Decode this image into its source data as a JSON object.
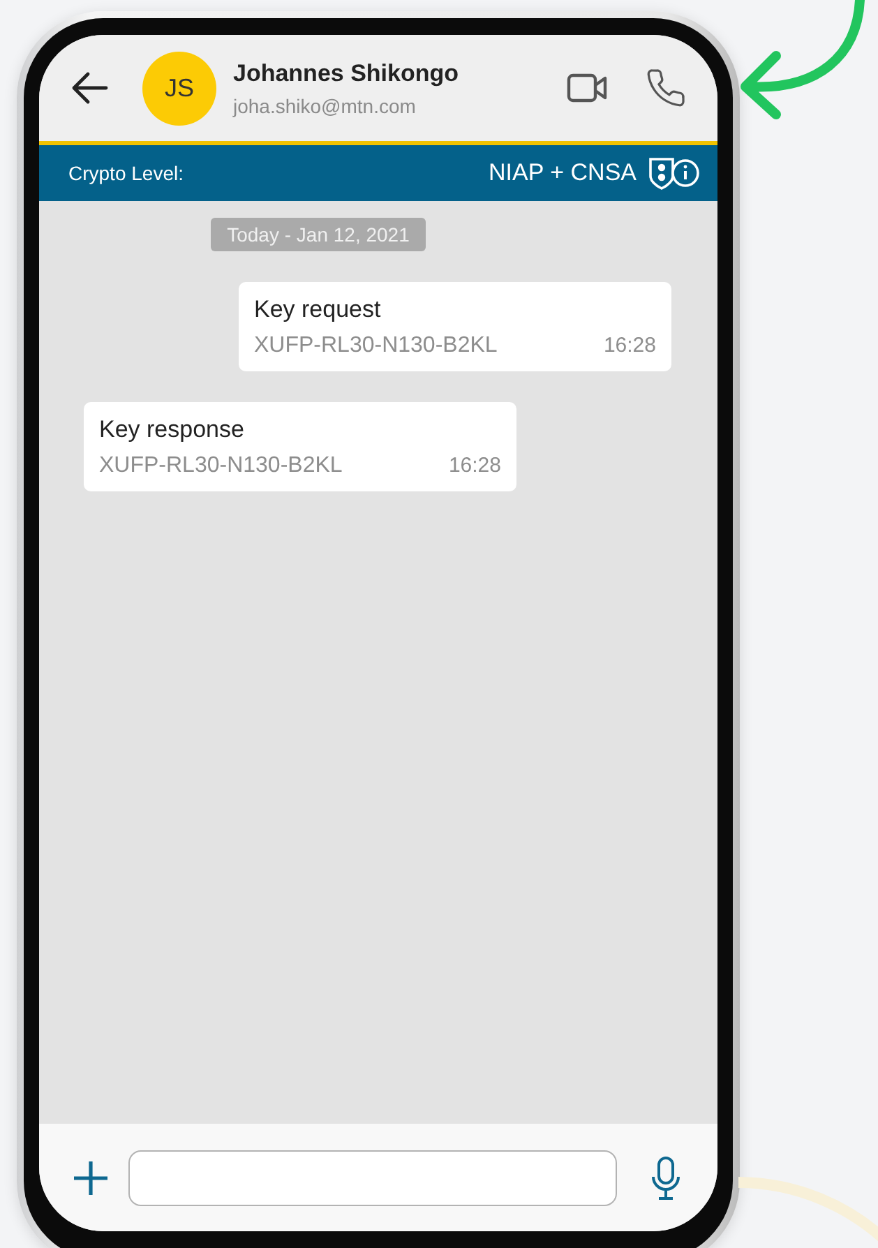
{
  "header": {
    "avatar_initials": "JS",
    "name": "Johannes Shikongo",
    "email": "joha.shiko@mtn.com"
  },
  "crypto_bar": {
    "label": "Crypto Level:",
    "value": "NIAP + CNSA"
  },
  "date_divider": "Today - Jan 12, 2021",
  "messages": [
    {
      "kind": "outgoing",
      "title": "Key request",
      "code": "XUFP-RL30-N130-B2KL",
      "time": "16:28"
    },
    {
      "kind": "incoming",
      "title": "Key response",
      "code": "XUFP-RL30-N130-B2KL",
      "time": "16:28"
    }
  ]
}
